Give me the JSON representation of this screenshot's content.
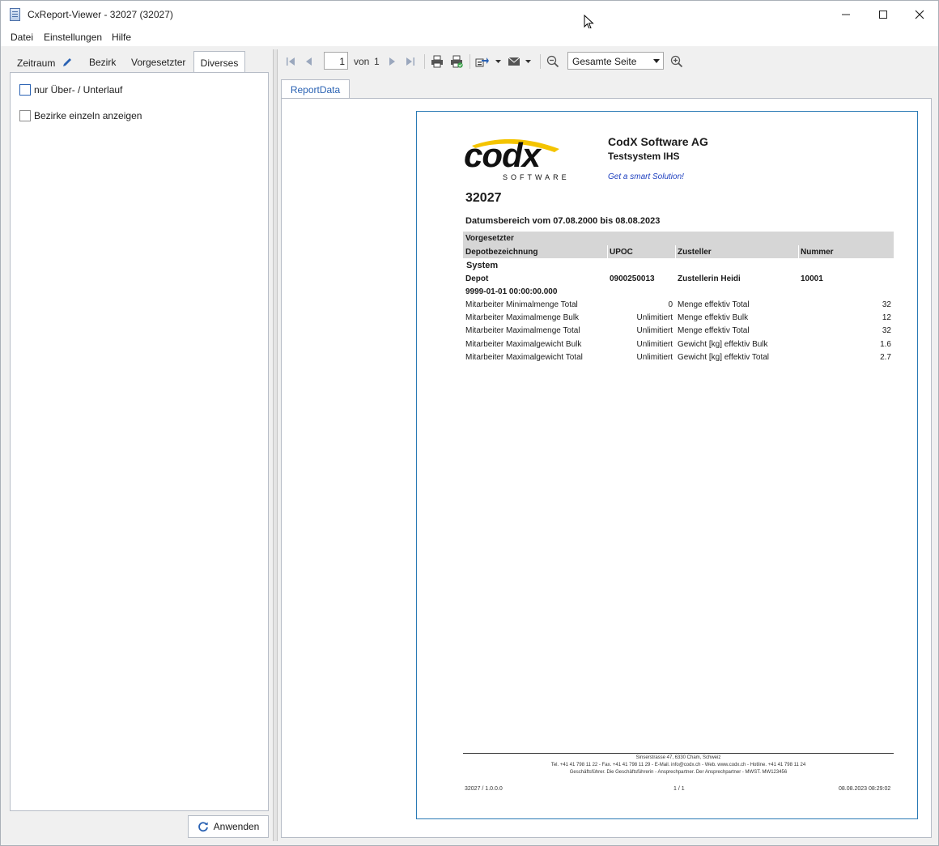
{
  "window": {
    "title": "CxReport-Viewer - 32027 (32027)"
  },
  "menu": {
    "datei": "Datei",
    "einstellungen": "Einstellungen",
    "hilfe": "Hilfe"
  },
  "left_tabs": {
    "zeitraum": "Zeitraum",
    "bezirk": "Bezirk",
    "vorgesetzter": "Vorgesetzter",
    "diverses": "Diverses"
  },
  "options": [
    {
      "label": "nur Über- / Unterlauf",
      "checked": false
    },
    {
      "label": "Bezirke einzeln anzeigen",
      "checked": false
    }
  ],
  "apply_label": "Anwenden",
  "toolbar": {
    "page_current": "1",
    "page_of": "von",
    "page_total": "1",
    "zoom": "Gesamte Seite"
  },
  "report_tab": "ReportData",
  "report": {
    "company": "CodX Software AG",
    "system": "Testsystem IHS",
    "slogan": "Get a smart Solution!",
    "logo_word": "codx",
    "logo_sub": "SOFTWARE",
    "number": "32027",
    "date_range": "Datumsbereich vom 07.08.2000 bis 08.08.2023",
    "group_header": "Vorgesetzter",
    "columns": [
      "Depotbezeichnung",
      "UPOC",
      "Zusteller",
      "Nummer"
    ],
    "group_name": "System",
    "depot_row": [
      "Depot",
      "0900250013",
      "Zustellerin Heidi",
      "10001"
    ],
    "timestamp": "9999-01-01 00:00:00.000",
    "metrics": [
      {
        "label": "Mitarbeiter Minimalmenge Total",
        "limit": "0",
        "name": "Menge effektiv Total",
        "value": "32"
      },
      {
        "label": "Mitarbeiter Maximalmenge Bulk",
        "limit": "Unlimitiert",
        "name": "Menge effektiv Bulk",
        "value": "12"
      },
      {
        "label": "Mitarbeiter Maximalmenge Total",
        "limit": "Unlimitiert",
        "name": "Menge effektiv Total",
        "value": "32"
      },
      {
        "label": "Mitarbeiter Maximalgewicht Bulk",
        "limit": "Unlimitiert",
        "name": "Gewicht [kg] effektiv Bulk",
        "value": "1.6"
      },
      {
        "label": "Mitarbeiter Maximalgewicht Total",
        "limit": "Unlimitiert",
        "name": "Gewicht [kg] effektiv Total",
        "value": "2.7"
      }
    ],
    "footer": {
      "line1": "Sinserstrasse 47, 6330 Cham, Schweiz",
      "line2": "Tel. +41 41 798 11 22 - Fax. +41 41 798 11 29 - E-Mail. info@codx.ch - Web. www.codx.ch - Hotline. +41 41 798 11 24",
      "line3": "Geschäftsführer. Die Geschäftsführerin - Ansprechpartner. Der Ansprechpartner - MWST. MW123456",
      "version": "32027 / 1.0.0.0",
      "pages": "1 / 1",
      "printed": "08.08.2023 08:29:02"
    }
  }
}
